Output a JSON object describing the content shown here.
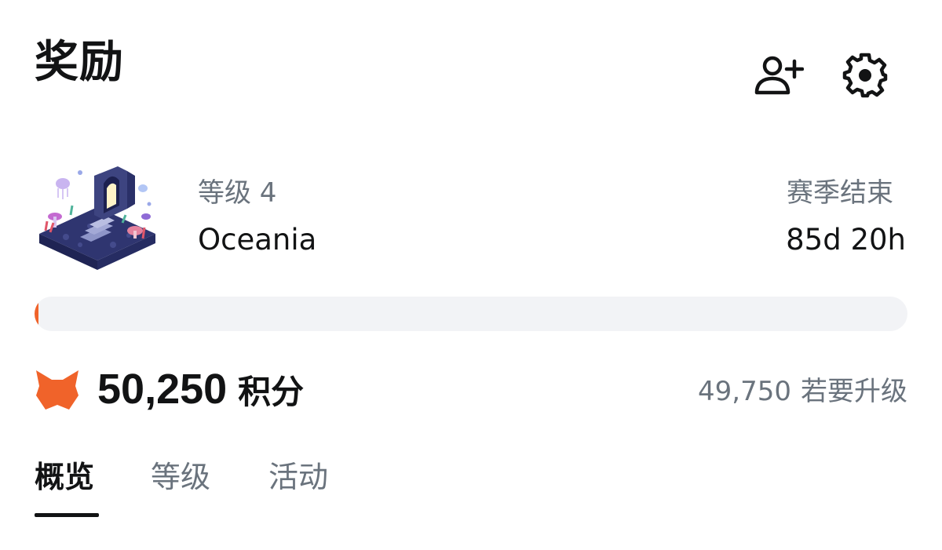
{
  "header": {
    "title": "奖励",
    "add_user_icon": "add-user-icon",
    "settings_icon": "gear-icon"
  },
  "season": {
    "level_label": "等级 4",
    "level_name": "Oceania",
    "end_label": "赛季结束",
    "end_value": "85d 20h",
    "art_icon": "season-landscape-image"
  },
  "progress": {
    "fraction": 0.002,
    "fill_color": "#f0632a",
    "track_color": "#f2f3f6"
  },
  "points": {
    "icon": "fox-icon",
    "value": "50,250",
    "unit": "积分",
    "to_next_value": "49,750",
    "to_next_label": "若要升级"
  },
  "tabs": [
    {
      "label": "概览",
      "active": true
    },
    {
      "label": "等级",
      "active": false
    },
    {
      "label": "活动",
      "active": false
    }
  ],
  "colors": {
    "accent": "#f0632a",
    "text_primary": "#121314",
    "text_secondary": "#6a737d"
  }
}
